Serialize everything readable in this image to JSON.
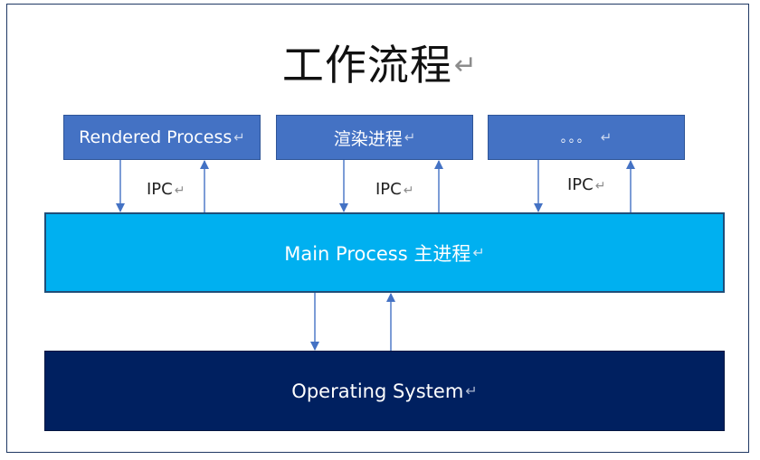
{
  "title": "工作流程",
  "return_mark": "↵",
  "processes": [
    {
      "label": "Rendered Process"
    },
    {
      "label": "渲染进程"
    },
    {
      "label": "。。。"
    }
  ],
  "ipc_labels": [
    "IPC",
    "IPC",
    "IPC"
  ],
  "main_process": {
    "label": "Main Process 主进程"
  },
  "os": {
    "label": "Operating System"
  },
  "colors": {
    "process_fill": "#4472c4",
    "main_fill": "#00b0f0",
    "os_fill": "#002060",
    "arrow": "#4472c4"
  }
}
